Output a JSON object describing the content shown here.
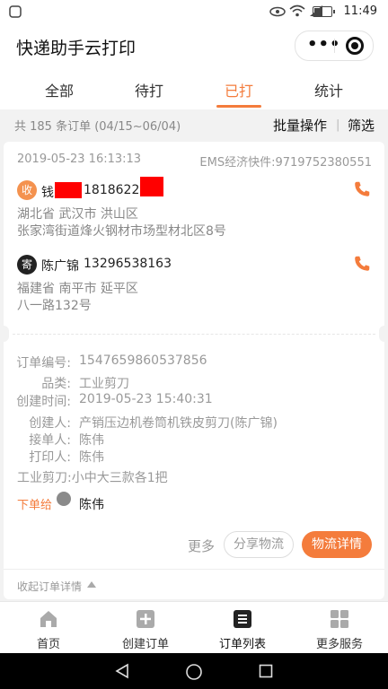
{
  "status_bar": {
    "time": "11:49",
    "icons": [
      "eye-icon",
      "wifi-icon",
      "signal-icon",
      "battery-icon"
    ]
  },
  "header": {
    "title": "快递助手云打印",
    "more_icon": "more-dots-icon",
    "close_icon": "target-icon"
  },
  "tabs": [
    {
      "label": "全部",
      "active": false
    },
    {
      "label": "待打",
      "active": false
    },
    {
      "label": "已打",
      "active": true
    },
    {
      "label": "统计",
      "active": false
    }
  ],
  "summary": {
    "count_text": "共 185 条订单 (04/15~06/04)",
    "batch_label": "批量操作",
    "separator": "|",
    "filter_label": "筛选"
  },
  "order": {
    "date": "2019-05-23 16:13:13",
    "express": "EMS经济快件:9719752380551",
    "recipient": {
      "tag": "收",
      "name": "钱",
      "phone": "18186222",
      "address_line1": "湖北省 武汉市 洪山区",
      "address_line2": "张家湾街道烽火钢材市场型材北区8号"
    },
    "sender": {
      "tag": "寄",
      "name": "陈广锦",
      "phone": "13296538163",
      "address_line1": "福建省 南平市 延平区",
      "address_line2": "八一路132号"
    },
    "details": {
      "order_no_label": "订单编号:",
      "order_no": "1547659860537856",
      "category_label": "品类:",
      "category": "工业剪刀",
      "created_time_label": "创建时间:",
      "created_time": "2019-05-23 15:40:31",
      "creator_label": "创建人:",
      "creator": "产销压边机卷筒机铁皮剪刀(陈广锦)",
      "receiver_label": "接单人:",
      "receiver": "陈伟",
      "printer_label": "打印人:",
      "printer": "陈伟",
      "item_note": "工业剪刀:小中大三款各1把",
      "assign_label": "下单给",
      "assignee": "陈伟"
    },
    "actions": {
      "more": "更多",
      "share": "分享物流",
      "detail": "物流详情"
    },
    "collapse_label": "收起订单详情"
  },
  "bottom_nav": [
    {
      "label": "首页",
      "icon": "home-icon"
    },
    {
      "label": "创建订单",
      "icon": "add-order-icon"
    },
    {
      "label": "订单列表",
      "icon": "order-list-icon"
    },
    {
      "label": "更多服务",
      "icon": "more-services-icon"
    }
  ],
  "colors": {
    "accent": "#f47c3c",
    "recv_tag": "#f4924f",
    "redact": "#ff0000"
  }
}
